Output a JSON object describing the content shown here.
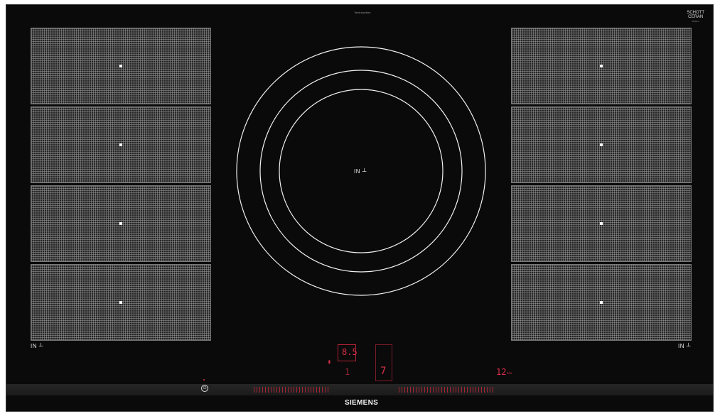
{
  "cooktop": {
    "brand": "SIEMENS",
    "top_caption": "flexInduction",
    "glass_brand": "SCHOTT",
    "glass_brand_sub": "CERAN",
    "glass_model": "Miradur",
    "left_zone_label": "IN",
    "right_zone_label": "IN",
    "center_zone_label": "IN",
    "left_zones": [
      "zone-1",
      "zone-2",
      "zone-3",
      "zone-4"
    ],
    "right_zones": [
      "zone-5",
      "zone-6",
      "zone-7",
      "zone-8"
    ]
  },
  "display": {
    "power_level": "8.5",
    "setting_left": "1",
    "setting_center": "7",
    "timer_value": "12",
    "timer_unit": "min"
  },
  "colors": {
    "glass": "#0a0a0a",
    "display_red": "#d9304a",
    "marking_white": "#ffffff"
  }
}
